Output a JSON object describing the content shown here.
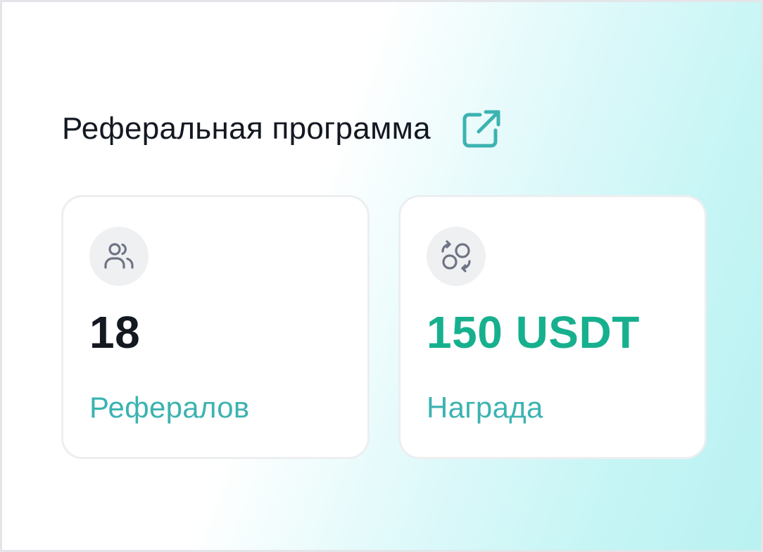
{
  "header": {
    "title": "Реферальная программа",
    "link_icon": "external-link-icon"
  },
  "cards": [
    {
      "icon": "users-icon",
      "value": "18",
      "label": "Рефералов"
    },
    {
      "icon": "exchange-coins-icon",
      "value": "150 USDT",
      "label": "Награда"
    }
  ],
  "colors": {
    "accent": "#3cb3b1",
    "reward": "#17b08e",
    "text": "#141821",
    "icon": "#6f7484"
  }
}
